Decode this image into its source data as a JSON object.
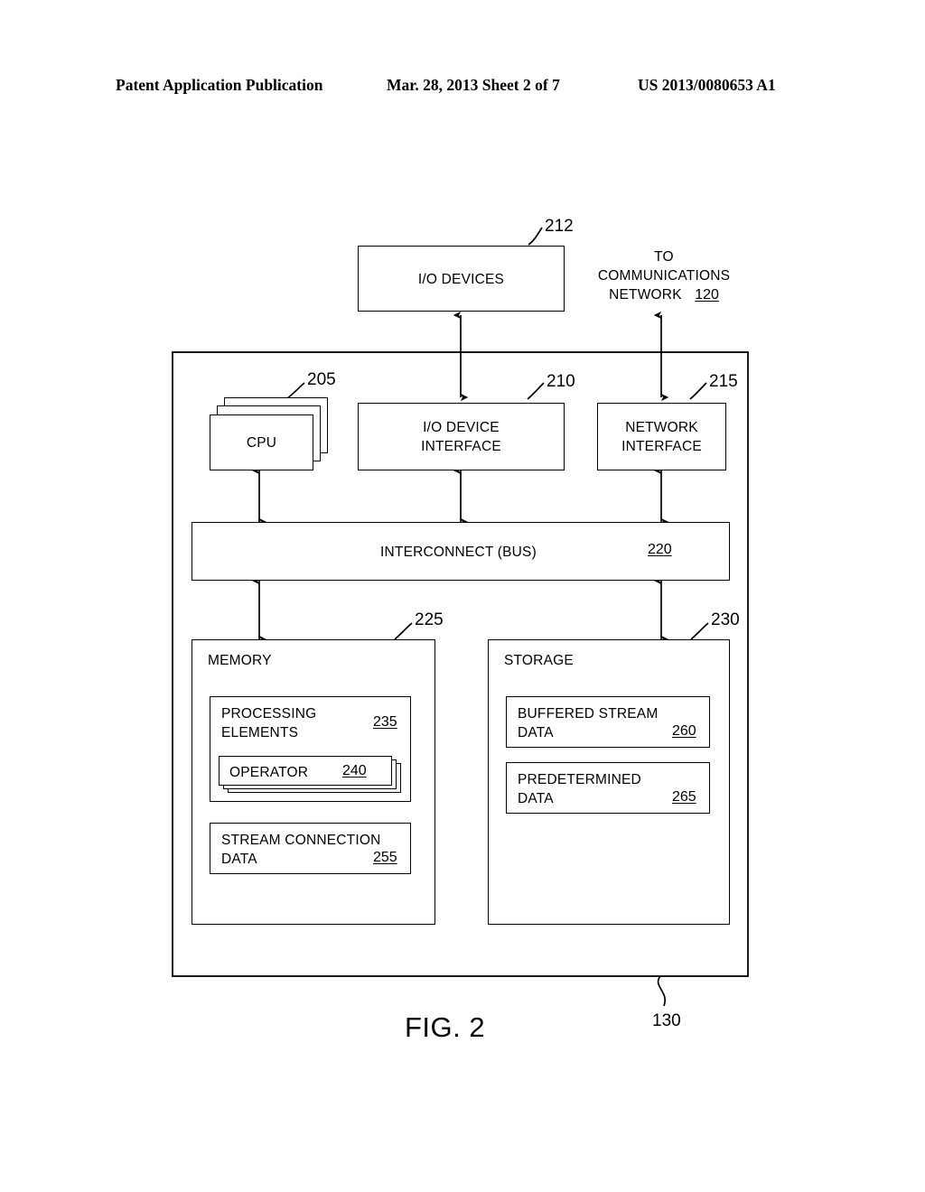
{
  "page_header": {
    "left": "Patent Application Publication",
    "middle": "Mar. 28, 2013  Sheet 2 of 7",
    "right": "US 2013/0080653 A1"
  },
  "figure": {
    "caption": "FIG. 2",
    "system_ref": "130"
  },
  "diagram": {
    "io_devices": {
      "label": "I/O DEVICES",
      "callout": "212"
    },
    "network_note": {
      "line1": "TO",
      "line2": "COMMUNICATIONS",
      "line3": "NETWORK",
      "ref": "120"
    },
    "cpu": {
      "label": "CPU",
      "callout": "205",
      "stack_count": 3
    },
    "io_device_interface": {
      "line1": "I/O DEVICE",
      "line2": "INTERFACE",
      "callout": "210"
    },
    "network_interface": {
      "line1": "NETWORK",
      "line2": "INTERFACE",
      "callout": "215"
    },
    "interconnect": {
      "label": "INTERCONNECT (BUS)",
      "ref": "220"
    },
    "memory": {
      "label": "MEMORY",
      "callout": "225",
      "processing_elements": {
        "line1": "PROCESSING",
        "line2": "ELEMENTS",
        "ref": "235",
        "operator": {
          "label": "OPERATOR",
          "ref": "240",
          "stack_count": 3
        }
      },
      "stream_connection_data": {
        "line1": "STREAM CONNECTION",
        "line2": "DATA",
        "ref": "255"
      }
    },
    "storage": {
      "label": "STORAGE",
      "callout": "230",
      "buffered_stream_data": {
        "line1": "BUFFERED STREAM",
        "line2": "DATA",
        "ref": "260"
      },
      "predetermined_data": {
        "line1": "PREDETERMINED",
        "line2": "DATA",
        "ref": "265"
      }
    }
  },
  "colors": {
    "ink": "#000000",
    "paper": "#ffffff"
  }
}
